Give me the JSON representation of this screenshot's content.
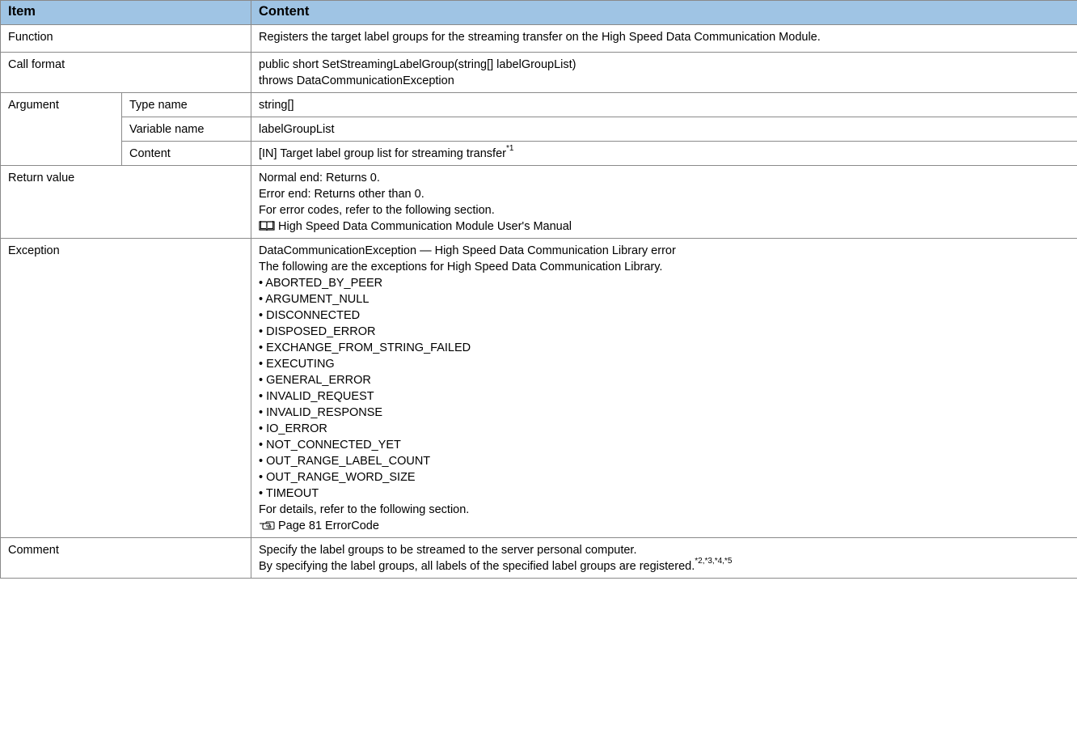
{
  "header": {
    "item": "Item",
    "content": "Content"
  },
  "function": {
    "label": "Function",
    "text": "Registers the target label groups for the streaming transfer on the High Speed Data Communication Module."
  },
  "call_format": {
    "label": "Call format",
    "lines": [
      "public short SetStreamingLabelGroup(string[] labelGroupList)",
      "throws DataCommunicationException"
    ]
  },
  "argument": {
    "label": "Argument",
    "type_name": {
      "label": "Type name",
      "value": "string[]"
    },
    "variable_name": {
      "label": "Variable name",
      "value": "labelGroupList"
    },
    "content": {
      "label": "Content",
      "value": "[IN] Target label group list for streaming transfer",
      "note": "*1"
    }
  },
  "return_value": {
    "label": "Return value",
    "lines": [
      "Normal end: Returns 0.",
      "Error end: Returns other than 0.",
      "For error codes, refer to the following section."
    ],
    "manual_ref": "High Speed Data Communication Module User's Manual",
    "manual_icon": "book-icon"
  },
  "exception": {
    "label": "Exception",
    "intro": [
      "DataCommunicationException — High Speed Data Communication Library error",
      "The following are the exceptions for High Speed Data Communication Library."
    ],
    "items": [
      "• ABORTED_BY_PEER",
      "• ARGUMENT_NULL",
      "• DISCONNECTED",
      "• DISPOSED_ERROR",
      "• EXCHANGE_FROM_STRING_FAILED",
      "• EXECUTING",
      "• GENERAL_ERROR",
      "• INVALID_REQUEST",
      "• INVALID_RESPONSE",
      "• IO_ERROR",
      "• NOT_CONNECTED_YET",
      "• OUT_RANGE_LABEL_COUNT",
      "• OUT_RANGE_WORD_SIZE",
      "• TIMEOUT"
    ],
    "details": "For details, refer to the following section.",
    "page_ref": "Page 81 ErrorCode",
    "page_icon": "pointing-hand-icon"
  },
  "comment": {
    "label": "Comment",
    "line1": "Specify the label groups to be streamed to the server personal computer.",
    "line2": "By specifying the label groups, all labels of the specified label groups are registered.",
    "note": "*2,*3,*4,*5"
  },
  "colors": {
    "header_bg": "#9fc4e4",
    "border": "#8a8a8a"
  }
}
